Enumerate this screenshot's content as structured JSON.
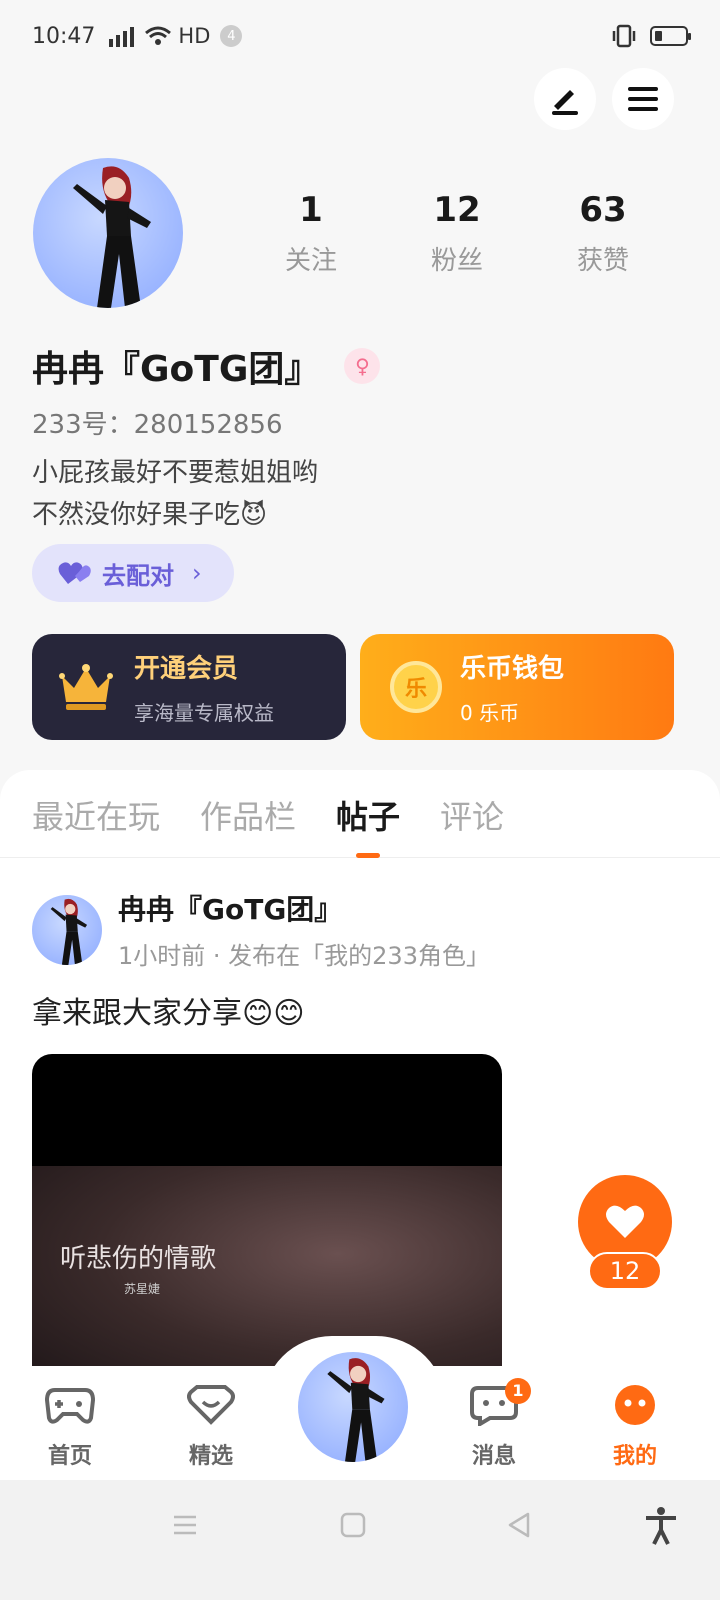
{
  "status_bar": {
    "time": "10:47",
    "network": "4G",
    "hd": "HD",
    "notif_count": "4"
  },
  "profile": {
    "stats": [
      {
        "value": "1",
        "label": "关注"
      },
      {
        "value": "12",
        "label": "粉丝"
      },
      {
        "value": "63",
        "label": "获赞"
      }
    ],
    "name": "冉冉『GoTG团』",
    "uid": "233号：280152856",
    "bio_line1": "小屁孩最好不要惹姐姐哟",
    "bio_line2": "不然没你好果子吃😈",
    "match_label": "去配对"
  },
  "cards": {
    "vip": {
      "title": "开通会员",
      "subtitle": "享海量专属权益"
    },
    "wallet": {
      "title": "乐币钱包",
      "subtitle": "0 乐币",
      "coin_glyph": "乐"
    }
  },
  "tabs": [
    {
      "label": "最近在玩",
      "active": false
    },
    {
      "label": "作品栏",
      "active": false
    },
    {
      "label": "帖子",
      "active": true
    },
    {
      "label": "评论",
      "active": false
    }
  ],
  "post": {
    "author": "冉冉『GoTG团』",
    "meta": "1小时前 · 发布在「我的233角色」",
    "text": "拿来跟大家分享😊😊",
    "media_caption": "听悲伤的情歌",
    "media_subcaption": "苏星婕",
    "like_count": "12"
  },
  "nav": {
    "items": [
      {
        "label": "首页",
        "icon": "gamepad-icon"
      },
      {
        "label": "精选",
        "icon": "heart-gem-icon"
      },
      {
        "label": "消息",
        "icon": "chat-icon",
        "badge": "1"
      },
      {
        "label": "我的",
        "icon": "smile-icon",
        "active": true
      }
    ]
  },
  "colors": {
    "accent": "#ff6a13",
    "vip_bg": "#27263a",
    "match_bg": "#e3e3fb",
    "match_text": "#6a5fd8"
  }
}
